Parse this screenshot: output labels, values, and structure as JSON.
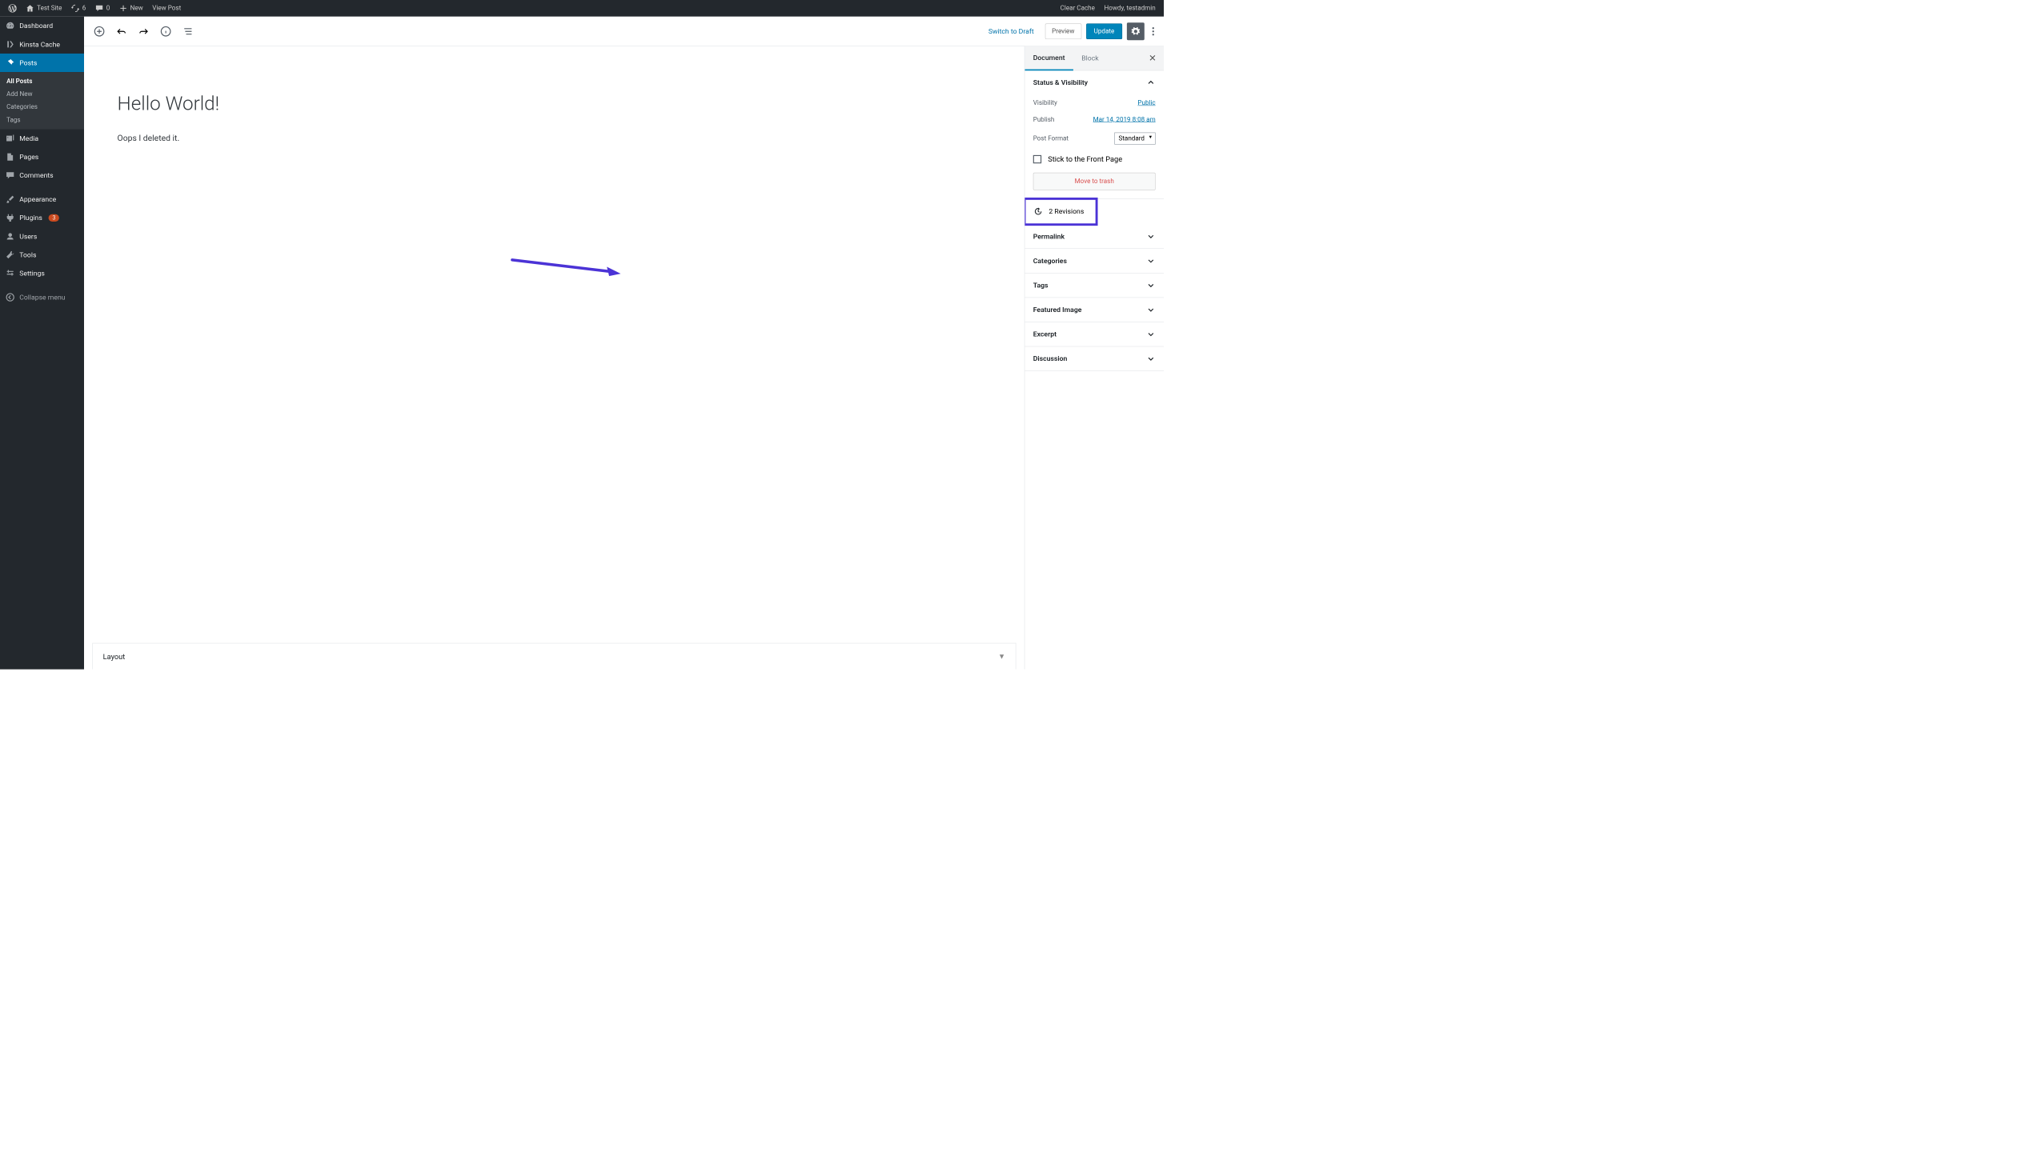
{
  "adminbar": {
    "site_name": "Test Site",
    "updates_count": "6",
    "comments_count": "0",
    "new_label": "New",
    "view_post": "View Post",
    "clear_cache": "Clear Cache",
    "howdy": "Howdy, testadmin"
  },
  "sidebar": {
    "dashboard": "Dashboard",
    "kinsta_cache": "Kinsta Cache",
    "posts": "Posts",
    "posts_sub": {
      "all": "All Posts",
      "add": "Add New",
      "cats": "Categories",
      "tags": "Tags"
    },
    "media": "Media",
    "pages": "Pages",
    "comments": "Comments",
    "appearance": "Appearance",
    "plugins": "Plugins",
    "plugins_badge": "3",
    "users": "Users",
    "tools": "Tools",
    "settings": "Settings",
    "collapse": "Collapse menu"
  },
  "editor": {
    "switch_to_draft": "Switch to Draft",
    "preview": "Preview",
    "update": "Update",
    "post_title": "Hello World!",
    "post_body": "Oops I deleted it.",
    "layout_label": "Layout"
  },
  "settings_panel": {
    "tab_document": "Document",
    "tab_block": "Block",
    "status_title": "Status & Visibility",
    "visibility_label": "Visibility",
    "visibility_value": "Public",
    "publish_label": "Publish",
    "publish_value": "Mar 14, 2019 8:08 am",
    "format_label": "Post Format",
    "format_value": "Standard",
    "stick_label": "Stick to the Front Page",
    "trash_label": "Move to trash",
    "revisions_label": "2 Revisions",
    "permalink": "Permalink",
    "categories": "Categories",
    "tags": "Tags",
    "featured": "Featured Image",
    "excerpt": "Excerpt",
    "discussion": "Discussion"
  }
}
